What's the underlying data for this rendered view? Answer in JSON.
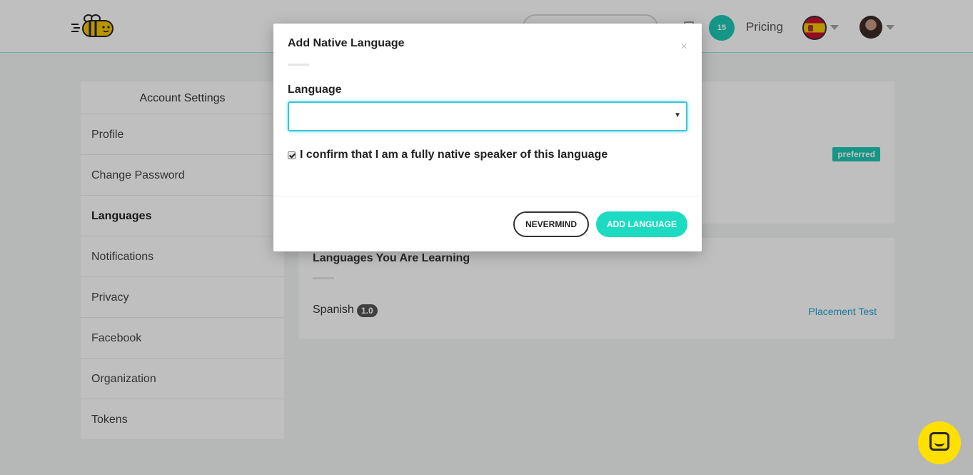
{
  "header": {
    "logo_icon": "bee-logo-icon",
    "coins": "15",
    "pricing_label": "Pricing",
    "flag_icon": "spain-flag-icon",
    "avatar_icon": "user-avatar-icon"
  },
  "sidebar": {
    "title": "Account Settings",
    "items": [
      {
        "label": "Profile",
        "active": false
      },
      {
        "label": "Change Password",
        "active": false
      },
      {
        "label": "Languages",
        "active": true
      },
      {
        "label": "Notifications",
        "active": false
      },
      {
        "label": "Privacy",
        "active": false
      },
      {
        "label": "Facebook",
        "active": false
      },
      {
        "label": "Organization",
        "active": false
      },
      {
        "label": "Tokens",
        "active": false
      }
    ]
  },
  "native_card": {
    "badge": "preferred"
  },
  "learning_card": {
    "title": "Languages You Are Learning",
    "language": "Spanish",
    "level": "1.0",
    "placement_link": "Placement Test"
  },
  "modal": {
    "title": "Add Native Language",
    "close_label": "×",
    "field_label": "Language",
    "select_value": "",
    "select_arrow": "▼",
    "confirm_text": "I confirm that I am a fully native speaker of this language",
    "confirm_checked": true,
    "nevermind_label": "NEVERMIND",
    "add_label": "ADD LANGUAGE"
  },
  "colors": {
    "accent": "#1cdbc2",
    "link": "#21a3cf",
    "chat": "#ffe000"
  }
}
